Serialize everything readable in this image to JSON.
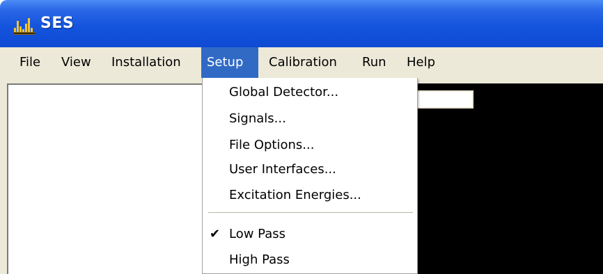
{
  "window": {
    "title": "SES",
    "icon": "ses-app-icon"
  },
  "menubar": {
    "items": [
      {
        "label": "File"
      },
      {
        "label": "View"
      },
      {
        "label": "Installation"
      },
      {
        "label": "Setup"
      },
      {
        "label": "Calibration"
      },
      {
        "label": "Run"
      },
      {
        "label": "Help"
      }
    ],
    "active": "Setup"
  },
  "setup_menu": {
    "items": [
      {
        "label": "Global Detector..."
      },
      {
        "label": "Signals..."
      },
      {
        "label": "File Options..."
      },
      {
        "label": "User Interfaces..."
      },
      {
        "label": "Excitation Energies..."
      },
      {
        "label": "Low Pass",
        "checked": true
      },
      {
        "label": "High Pass",
        "checked": false
      }
    ],
    "check_icon": "check-mark-icon"
  },
  "colors": {
    "titlebar": "#0f4ad3",
    "menu_highlight": "#316ac5",
    "menubar_bg": "#ece9d8",
    "panel_black": "#000000"
  }
}
